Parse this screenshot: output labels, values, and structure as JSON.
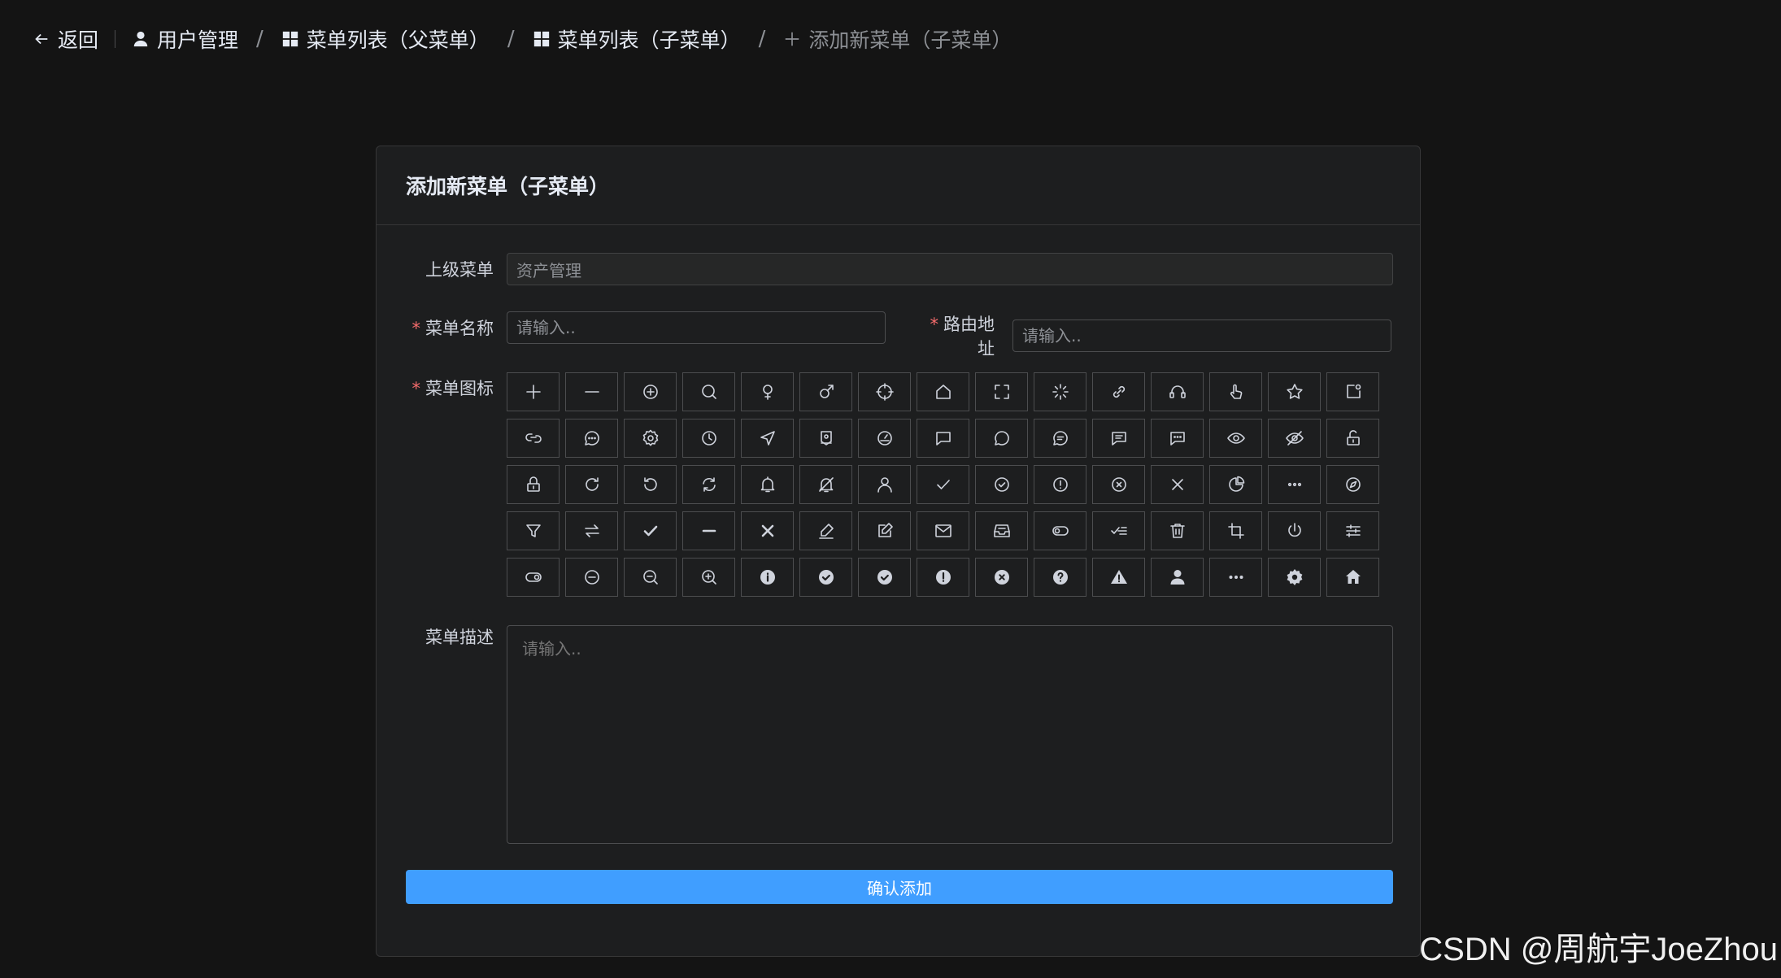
{
  "breadcrumb": {
    "back": "返回",
    "user_mgmt": "用户管理",
    "parent_list": "菜单列表（父菜单）",
    "child_list": "菜单列表（子菜单）",
    "current": "添加新菜单（子菜单）",
    "sep": "/"
  },
  "card": {
    "title": "添加新菜单（子菜单）"
  },
  "form": {
    "parent_menu_label": "上级菜单",
    "parent_menu_value": "资产管理",
    "required_mark": "*",
    "menu_name_label": "菜单名称",
    "menu_name_placeholder": "请输入..",
    "route_label": "路由地址",
    "route_placeholder": "请输入..",
    "icon_label": "菜单图标",
    "desc_label": "菜单描述",
    "desc_placeholder": "请输入..",
    "submit_label": "确认添加"
  },
  "icons": [
    "plus-icon",
    "minus-icon",
    "circle-plus-icon",
    "search-icon",
    "female-icon",
    "male-icon",
    "aim-icon",
    "house-icon",
    "full-screen-icon",
    "loading-icon",
    "link-icon",
    "service-icon",
    "pointer-icon",
    "star-icon",
    "notification-icon",
    "connection-icon",
    "chat-dot-round-icon",
    "setting-icon",
    "clock-icon",
    "position-icon",
    "discount-icon",
    "odometer-icon",
    "chat-square-icon",
    "chat-round-icon",
    "chat-line-round-icon",
    "chat-line-square-icon",
    "chat-dot-square-icon",
    "view-icon",
    "hide-icon",
    "unlock-icon",
    "lock-icon",
    "refresh-right-icon",
    "refresh-left-icon",
    "refresh-icon",
    "bell-icon",
    "mute-notification-icon",
    "user-icon",
    "check-icon",
    "circle-check-icon",
    "warning-icon",
    "circle-close-icon",
    "close-icon",
    "pie-chart-icon",
    "more-icon",
    "compass-icon",
    "filter-icon",
    "switch-icon",
    "select-icon",
    "semi-select-icon",
    "close-bold-icon",
    "edit-pen-icon",
    "edit-icon",
    "message-icon",
    "message-box-icon",
    "turn-off-icon",
    "finished-icon",
    "delete-icon",
    "crop-icon",
    "switch-button-icon",
    "operation-icon",
    "open-icon",
    "remove-icon",
    "zoom-out-icon",
    "zoom-in-icon",
    "info-filled-icon",
    "circle-check-filled-icon",
    "success-filled-icon",
    "warning-filled-icon",
    "circle-close-filled-icon",
    "question-filled-icon",
    "warn-triangle-filled-icon",
    "user-filled-icon",
    "more-filled-icon",
    "tools-icon",
    "home-filled-icon"
  ],
  "watermark": "CSDN @周航宇JoeZhou"
}
